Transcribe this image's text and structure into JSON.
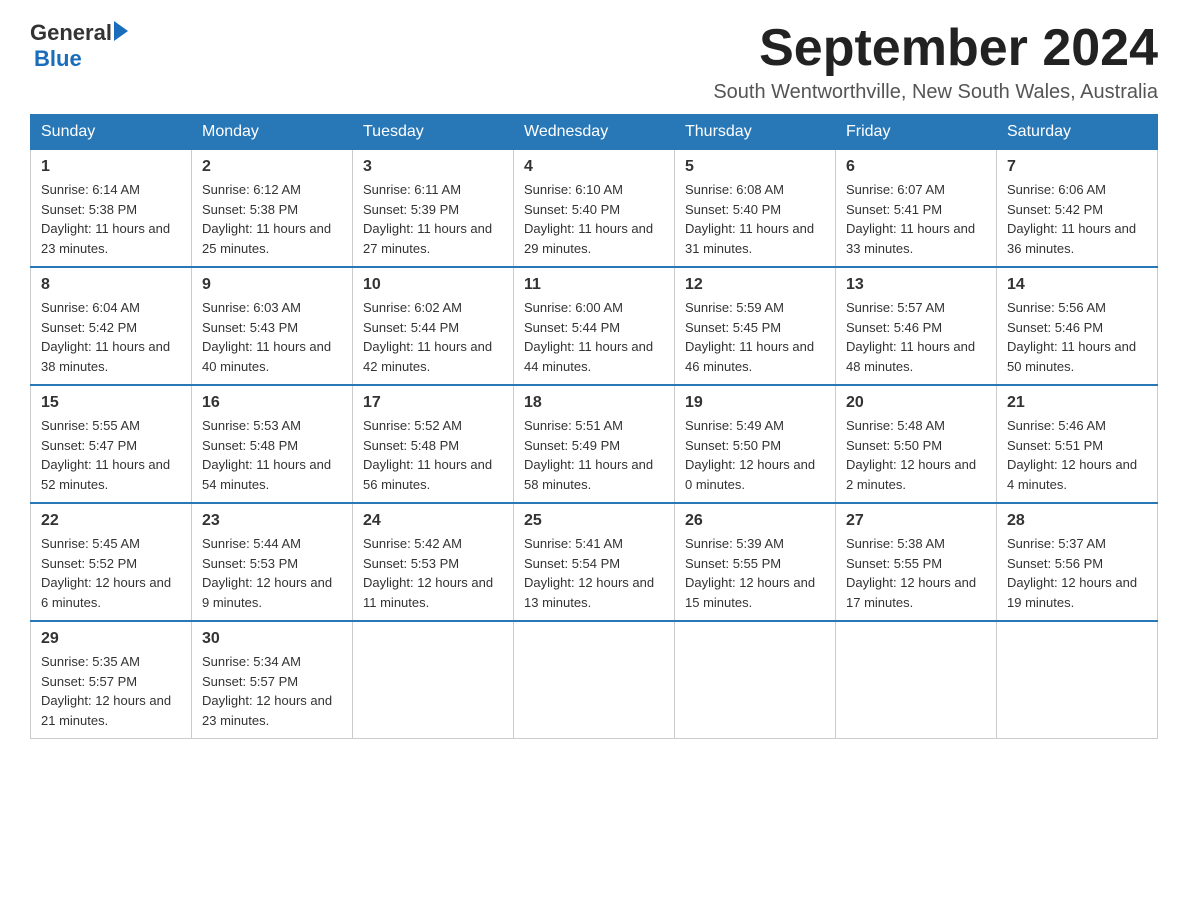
{
  "header": {
    "logo_general": "General",
    "logo_blue": "Blue",
    "title": "September 2024",
    "subtitle": "South Wentworthville, New South Wales, Australia"
  },
  "days_of_week": [
    "Sunday",
    "Monday",
    "Tuesday",
    "Wednesday",
    "Thursday",
    "Friday",
    "Saturday"
  ],
  "weeks": [
    [
      {
        "day": "1",
        "sunrise": "6:14 AM",
        "sunset": "5:38 PM",
        "daylight": "11 hours and 23 minutes."
      },
      {
        "day": "2",
        "sunrise": "6:12 AM",
        "sunset": "5:38 PM",
        "daylight": "11 hours and 25 minutes."
      },
      {
        "day": "3",
        "sunrise": "6:11 AM",
        "sunset": "5:39 PM",
        "daylight": "11 hours and 27 minutes."
      },
      {
        "day": "4",
        "sunrise": "6:10 AM",
        "sunset": "5:40 PM",
        "daylight": "11 hours and 29 minutes."
      },
      {
        "day": "5",
        "sunrise": "6:08 AM",
        "sunset": "5:40 PM",
        "daylight": "11 hours and 31 minutes."
      },
      {
        "day": "6",
        "sunrise": "6:07 AM",
        "sunset": "5:41 PM",
        "daylight": "11 hours and 33 minutes."
      },
      {
        "day": "7",
        "sunrise": "6:06 AM",
        "sunset": "5:42 PM",
        "daylight": "11 hours and 36 minutes."
      }
    ],
    [
      {
        "day": "8",
        "sunrise": "6:04 AM",
        "sunset": "5:42 PM",
        "daylight": "11 hours and 38 minutes."
      },
      {
        "day": "9",
        "sunrise": "6:03 AM",
        "sunset": "5:43 PM",
        "daylight": "11 hours and 40 minutes."
      },
      {
        "day": "10",
        "sunrise": "6:02 AM",
        "sunset": "5:44 PM",
        "daylight": "11 hours and 42 minutes."
      },
      {
        "day": "11",
        "sunrise": "6:00 AM",
        "sunset": "5:44 PM",
        "daylight": "11 hours and 44 minutes."
      },
      {
        "day": "12",
        "sunrise": "5:59 AM",
        "sunset": "5:45 PM",
        "daylight": "11 hours and 46 minutes."
      },
      {
        "day": "13",
        "sunrise": "5:57 AM",
        "sunset": "5:46 PM",
        "daylight": "11 hours and 48 minutes."
      },
      {
        "day": "14",
        "sunrise": "5:56 AM",
        "sunset": "5:46 PM",
        "daylight": "11 hours and 50 minutes."
      }
    ],
    [
      {
        "day": "15",
        "sunrise": "5:55 AM",
        "sunset": "5:47 PM",
        "daylight": "11 hours and 52 minutes."
      },
      {
        "day": "16",
        "sunrise": "5:53 AM",
        "sunset": "5:48 PM",
        "daylight": "11 hours and 54 minutes."
      },
      {
        "day": "17",
        "sunrise": "5:52 AM",
        "sunset": "5:48 PM",
        "daylight": "11 hours and 56 minutes."
      },
      {
        "day": "18",
        "sunrise": "5:51 AM",
        "sunset": "5:49 PM",
        "daylight": "11 hours and 58 minutes."
      },
      {
        "day": "19",
        "sunrise": "5:49 AM",
        "sunset": "5:50 PM",
        "daylight": "12 hours and 0 minutes."
      },
      {
        "day": "20",
        "sunrise": "5:48 AM",
        "sunset": "5:50 PM",
        "daylight": "12 hours and 2 minutes."
      },
      {
        "day": "21",
        "sunrise": "5:46 AM",
        "sunset": "5:51 PM",
        "daylight": "12 hours and 4 minutes."
      }
    ],
    [
      {
        "day": "22",
        "sunrise": "5:45 AM",
        "sunset": "5:52 PM",
        "daylight": "12 hours and 6 minutes."
      },
      {
        "day": "23",
        "sunrise": "5:44 AM",
        "sunset": "5:53 PM",
        "daylight": "12 hours and 9 minutes."
      },
      {
        "day": "24",
        "sunrise": "5:42 AM",
        "sunset": "5:53 PM",
        "daylight": "12 hours and 11 minutes."
      },
      {
        "day": "25",
        "sunrise": "5:41 AM",
        "sunset": "5:54 PM",
        "daylight": "12 hours and 13 minutes."
      },
      {
        "day": "26",
        "sunrise": "5:39 AM",
        "sunset": "5:55 PM",
        "daylight": "12 hours and 15 minutes."
      },
      {
        "day": "27",
        "sunrise": "5:38 AM",
        "sunset": "5:55 PM",
        "daylight": "12 hours and 17 minutes."
      },
      {
        "day": "28",
        "sunrise": "5:37 AM",
        "sunset": "5:56 PM",
        "daylight": "12 hours and 19 minutes."
      }
    ],
    [
      {
        "day": "29",
        "sunrise": "5:35 AM",
        "sunset": "5:57 PM",
        "daylight": "12 hours and 21 minutes."
      },
      {
        "day": "30",
        "sunrise": "5:34 AM",
        "sunset": "5:57 PM",
        "daylight": "12 hours and 23 minutes."
      },
      null,
      null,
      null,
      null,
      null
    ]
  ],
  "labels": {
    "sunrise_prefix": "Sunrise: ",
    "sunset_prefix": "Sunset: ",
    "daylight_prefix": "Daylight: "
  }
}
